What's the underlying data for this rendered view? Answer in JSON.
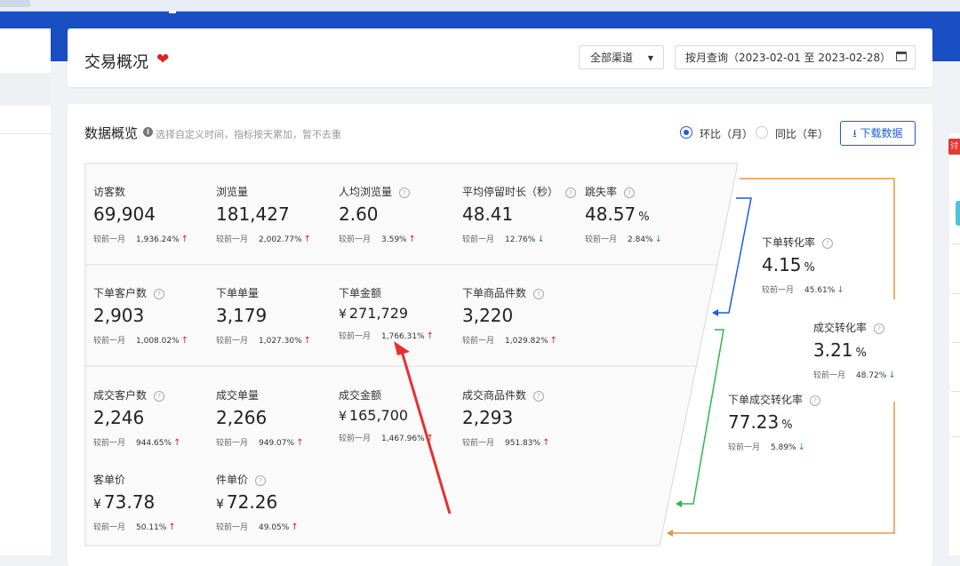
{
  "card1": {
    "title": "交易概况",
    "heart_icon": "heart-icon",
    "channel_select": "全部渠道",
    "date_range": "按月查询（2023-02-01 至 2023-02-28）"
  },
  "card2": {
    "title": "数据概览",
    "hint": "选择自定义时间，指标按天累加，暂不去重",
    "radio_mom": "环比（月）",
    "radio_yoy": "同比（年）",
    "download": "下载数据"
  },
  "cmp_label": "较前一月",
  "metrics": {
    "visitors": {
      "label": "访客数",
      "value": "69,904",
      "pct": "1,936.24%",
      "dir": "up"
    },
    "pageviews": {
      "label": "浏览量",
      "value": "181,427",
      "pct": "2,002.77%",
      "dir": "up"
    },
    "pv_per_user": {
      "label": "人均浏览量",
      "value": "2.60",
      "pct": "3.59%",
      "dir": "up"
    },
    "avg_stay": {
      "label": "平均停留时长（秒）",
      "value": "48.41",
      "pct": "12.76%",
      "dir": "down"
    },
    "bounce": {
      "label": "跳失率",
      "value": "48.57",
      "unit": "%",
      "pct": "2.84%",
      "dir": "down"
    },
    "order_customers": {
      "label": "下单客户数",
      "value": "2,903",
      "pct": "1,008.02%",
      "dir": "up"
    },
    "order_count": {
      "label": "下单单量",
      "value": "3,179",
      "pct": "1,027.30%",
      "dir": "up"
    },
    "order_amount": {
      "label": "下单金额",
      "currency": "¥",
      "value": "271,729",
      "pct": "1,766.31%",
      "dir": "up"
    },
    "order_items": {
      "label": "下单商品件数",
      "value": "3,220",
      "pct": "1,029.82%",
      "dir": "up"
    },
    "deal_customers": {
      "label": "成交客户数",
      "value": "2,246",
      "pct": "944.65%",
      "dir": "up"
    },
    "deal_count": {
      "label": "成交单量",
      "value": "2,266",
      "pct": "949.07%",
      "dir": "up"
    },
    "deal_amount": {
      "label": "成交金额",
      "currency": "¥",
      "value": "165,700",
      "pct": "1,467.96%",
      "dir": "up"
    },
    "deal_items": {
      "label": "成交商品件数",
      "value": "2,293",
      "pct": "951.83%",
      "dir": "up"
    },
    "per_customer": {
      "label": "客单价",
      "currency": "¥",
      "value": "73.78",
      "pct": "50.11%",
      "dir": "up"
    },
    "per_item": {
      "label": "件单价",
      "currency": "¥",
      "value": "72.26",
      "pct": "49.05%",
      "dir": "up"
    },
    "order_conv": {
      "label": "下单转化率",
      "value": "4.15",
      "unit": "%",
      "pct": "45.61%",
      "dir": "down"
    },
    "deal_conv": {
      "label": "成交转化率",
      "value": "3.21",
      "unit": "%",
      "pct": "48.72%",
      "dir": "down"
    },
    "order_deal_conv": {
      "label": "下单成交转化率",
      "value": "77.23",
      "unit": "%",
      "pct": "5.89%",
      "dir": "down"
    }
  },
  "right_badge": "讨",
  "colors": {
    "accent": "#1a5fd6",
    "up": "#e02020",
    "down": "#27a53a",
    "orange": "#e8953a",
    "green": "#2db84d",
    "blue": "#1a5fd6"
  }
}
